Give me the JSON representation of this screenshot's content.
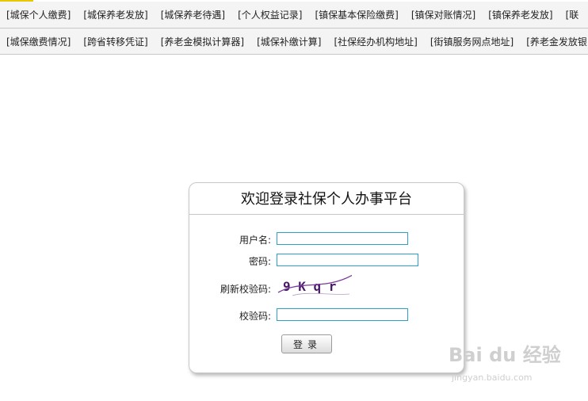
{
  "nav_row1": [
    "[城保个人缴费]",
    "[城保养老发放]",
    "[城保养老待遇]",
    "[个人权益记录]",
    "[镇保基本保险缴费]",
    "[镇保对账情况]",
    "[镇保养老发放]",
    "[联"
  ],
  "nav_row2": [
    "[城保缴费情况]",
    "[跨省转移凭证]",
    "[养老金模拟计算器]",
    "[城保补缴计算]",
    "[社保经办机构地址]",
    "[街镇服务网点地址]",
    "[养老金发放银"
  ],
  "login": {
    "title": "欢迎登录社保个人办事平台",
    "username_label": "用户名:",
    "username_value": "",
    "password_label": "密码:",
    "password_value": "",
    "refresh_captcha_label": "刷新校验码:",
    "captcha_text": "9 K q r",
    "verify_label": "校验码:",
    "verify_value": "",
    "submit_label": "登录"
  },
  "watermark": {
    "main": "Bai du 经验",
    "sub": "jingyan.baidu.com"
  },
  "colors": {
    "input_border": "#2a9fd0",
    "captcha_text": "#4a1a6a",
    "captcha_strike": "#7a3a9a",
    "accent": "#e8c800"
  }
}
